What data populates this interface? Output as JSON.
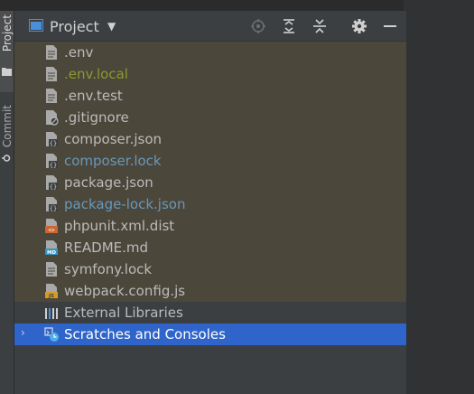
{
  "sidebar": {
    "project_tab": "Project",
    "commit_tab": "Commit"
  },
  "header": {
    "title": "Project",
    "caret": "▼",
    "actions": [
      "locate-icon",
      "expand-all-icon",
      "collapse-all-icon",
      "gear-icon",
      "minimize-icon"
    ]
  },
  "files": [
    {
      "name": ".env",
      "color": "#bbbbbb",
      "icon": "text-file-icon"
    },
    {
      "name": ".env.local",
      "color": "#8a9a2f",
      "icon": "text-file-icon"
    },
    {
      "name": ".env.test",
      "color": "#bbbbbb",
      "icon": "text-file-icon"
    },
    {
      "name": ".gitignore",
      "color": "#bbbbbb",
      "icon": "ignore-file-icon"
    },
    {
      "name": "composer.json",
      "color": "#bbbbbb",
      "icon": "json-file-icon"
    },
    {
      "name": "composer.lock",
      "color": "#6897bb",
      "icon": "json-file-icon"
    },
    {
      "name": "package.json",
      "color": "#bbbbbb",
      "icon": "json-file-icon"
    },
    {
      "name": "package-lock.json",
      "color": "#6897bb",
      "icon": "json-file-icon"
    },
    {
      "name": "phpunit.xml.dist",
      "color": "#bbbbbb",
      "icon": "xml-file-icon"
    },
    {
      "name": "README.md",
      "color": "#bbbbbb",
      "icon": "markdown-file-icon"
    },
    {
      "name": "symfony.lock",
      "color": "#bbbbbb",
      "icon": "text-file-icon"
    },
    {
      "name": "webpack.config.js",
      "color": "#bbbbbb",
      "icon": "javascript-file-icon"
    }
  ],
  "external_libraries": {
    "name": "External Libraries",
    "icon": "library-icon"
  },
  "scratches": {
    "name": "Scratches and Consoles",
    "icon": "scratches-icon",
    "expander": "›"
  },
  "colors": {
    "tinted_row": "#4c473b",
    "selected_row": "#2f65ca",
    "panel_bg": "#3c3f41"
  }
}
